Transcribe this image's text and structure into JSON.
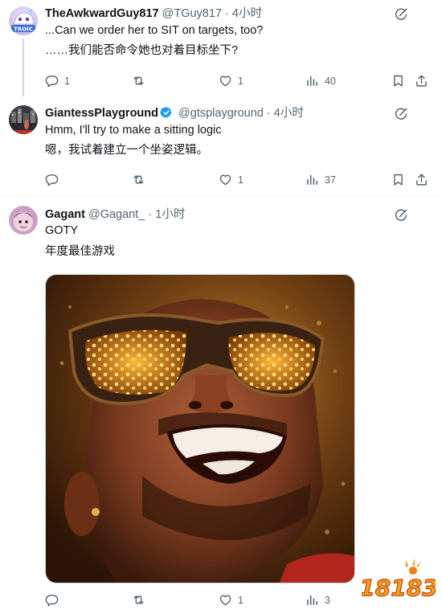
{
  "tweets": [
    {
      "name": "TheAwkwardGuy817",
      "handle": "@TGuy817",
      "sep": "·",
      "time": "4小时",
      "text": "...Can we order her to SIT on targets, too?",
      "translation": "……我们能否命令她也对着目标坐下?",
      "reply_count": "1",
      "repost_count": "",
      "like_count": "1",
      "view_count": "40"
    },
    {
      "name": "GiantessPlayground",
      "handle": "@gtsplayground",
      "sep": "·",
      "time": "4小时",
      "text": "Hmm, I'll try to make a sitting logic",
      "translation": "嗯，我试着建立一个坐姿逻辑。",
      "reply_count": "",
      "repost_count": "",
      "like_count": "1",
      "view_count": "37",
      "verified": true
    },
    {
      "name": "Gagant",
      "handle": "@Gagant_",
      "sep": "·",
      "time": "1小时",
      "text": "GOTY",
      "translation": "年度最佳游戏",
      "reply_count": "",
      "repost_count": "",
      "like_count": "1",
      "view_count": "3"
    }
  ],
  "avatar1_text": "TROIC",
  "watermark_text": "18183",
  "colors": {
    "text": "#0f1419",
    "secondary": "#536471",
    "verified": "#1d9bf0",
    "thread_line": "#cfd9de"
  },
  "icons": [
    "reply-icon",
    "repost-icon",
    "like-icon",
    "views-icon",
    "bookmark-icon",
    "share-icon",
    "grok-icon"
  ]
}
